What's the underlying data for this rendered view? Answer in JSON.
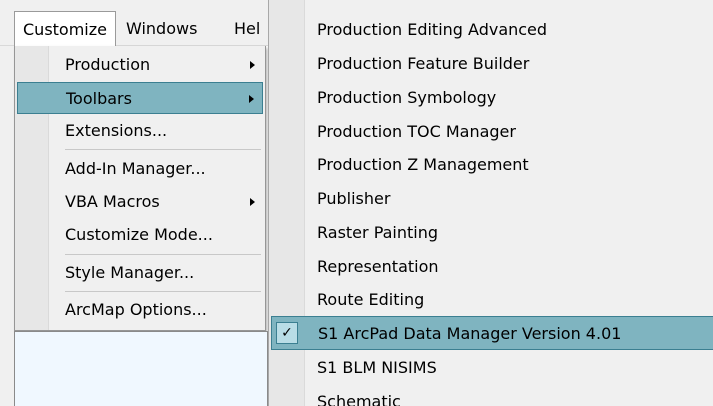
{
  "menubar": {
    "items": [
      "Customize",
      "Windows",
      "Hel"
    ]
  },
  "customize_menu": {
    "items": [
      {
        "label": "Production",
        "submenu": true
      },
      {
        "label": "Toolbars",
        "submenu": true,
        "highlighted": true
      },
      {
        "label": "Extensions..."
      },
      {
        "label": "Add-In Manager..."
      },
      {
        "label": "VBA Macros",
        "submenu": true
      },
      {
        "label": "Customize Mode..."
      },
      {
        "label": "Style Manager..."
      },
      {
        "label": "ArcMap Options..."
      }
    ]
  },
  "toolbars_submenu": {
    "items": [
      {
        "label": "Production Editing Advanced"
      },
      {
        "label": "Production Feature Builder"
      },
      {
        "label": "Production Symbology"
      },
      {
        "label": "Production TOC Manager"
      },
      {
        "label": "Production Z Management"
      },
      {
        "label": "Publisher"
      },
      {
        "label": "Raster Painting"
      },
      {
        "label": "Representation"
      },
      {
        "label": "Route Editing"
      },
      {
        "label": "S1 ArcPad Data Manager Version 4.01",
        "checked": true,
        "highlighted": true
      },
      {
        "label": "S1 BLM NISIMS"
      },
      {
        "label": "Schematic"
      }
    ],
    "check_mark": "✓"
  },
  "colors": {
    "highlight": "#7fb4c0",
    "highlight_border": "#3b7f91",
    "menu_bg": "#f0f0f0"
  }
}
